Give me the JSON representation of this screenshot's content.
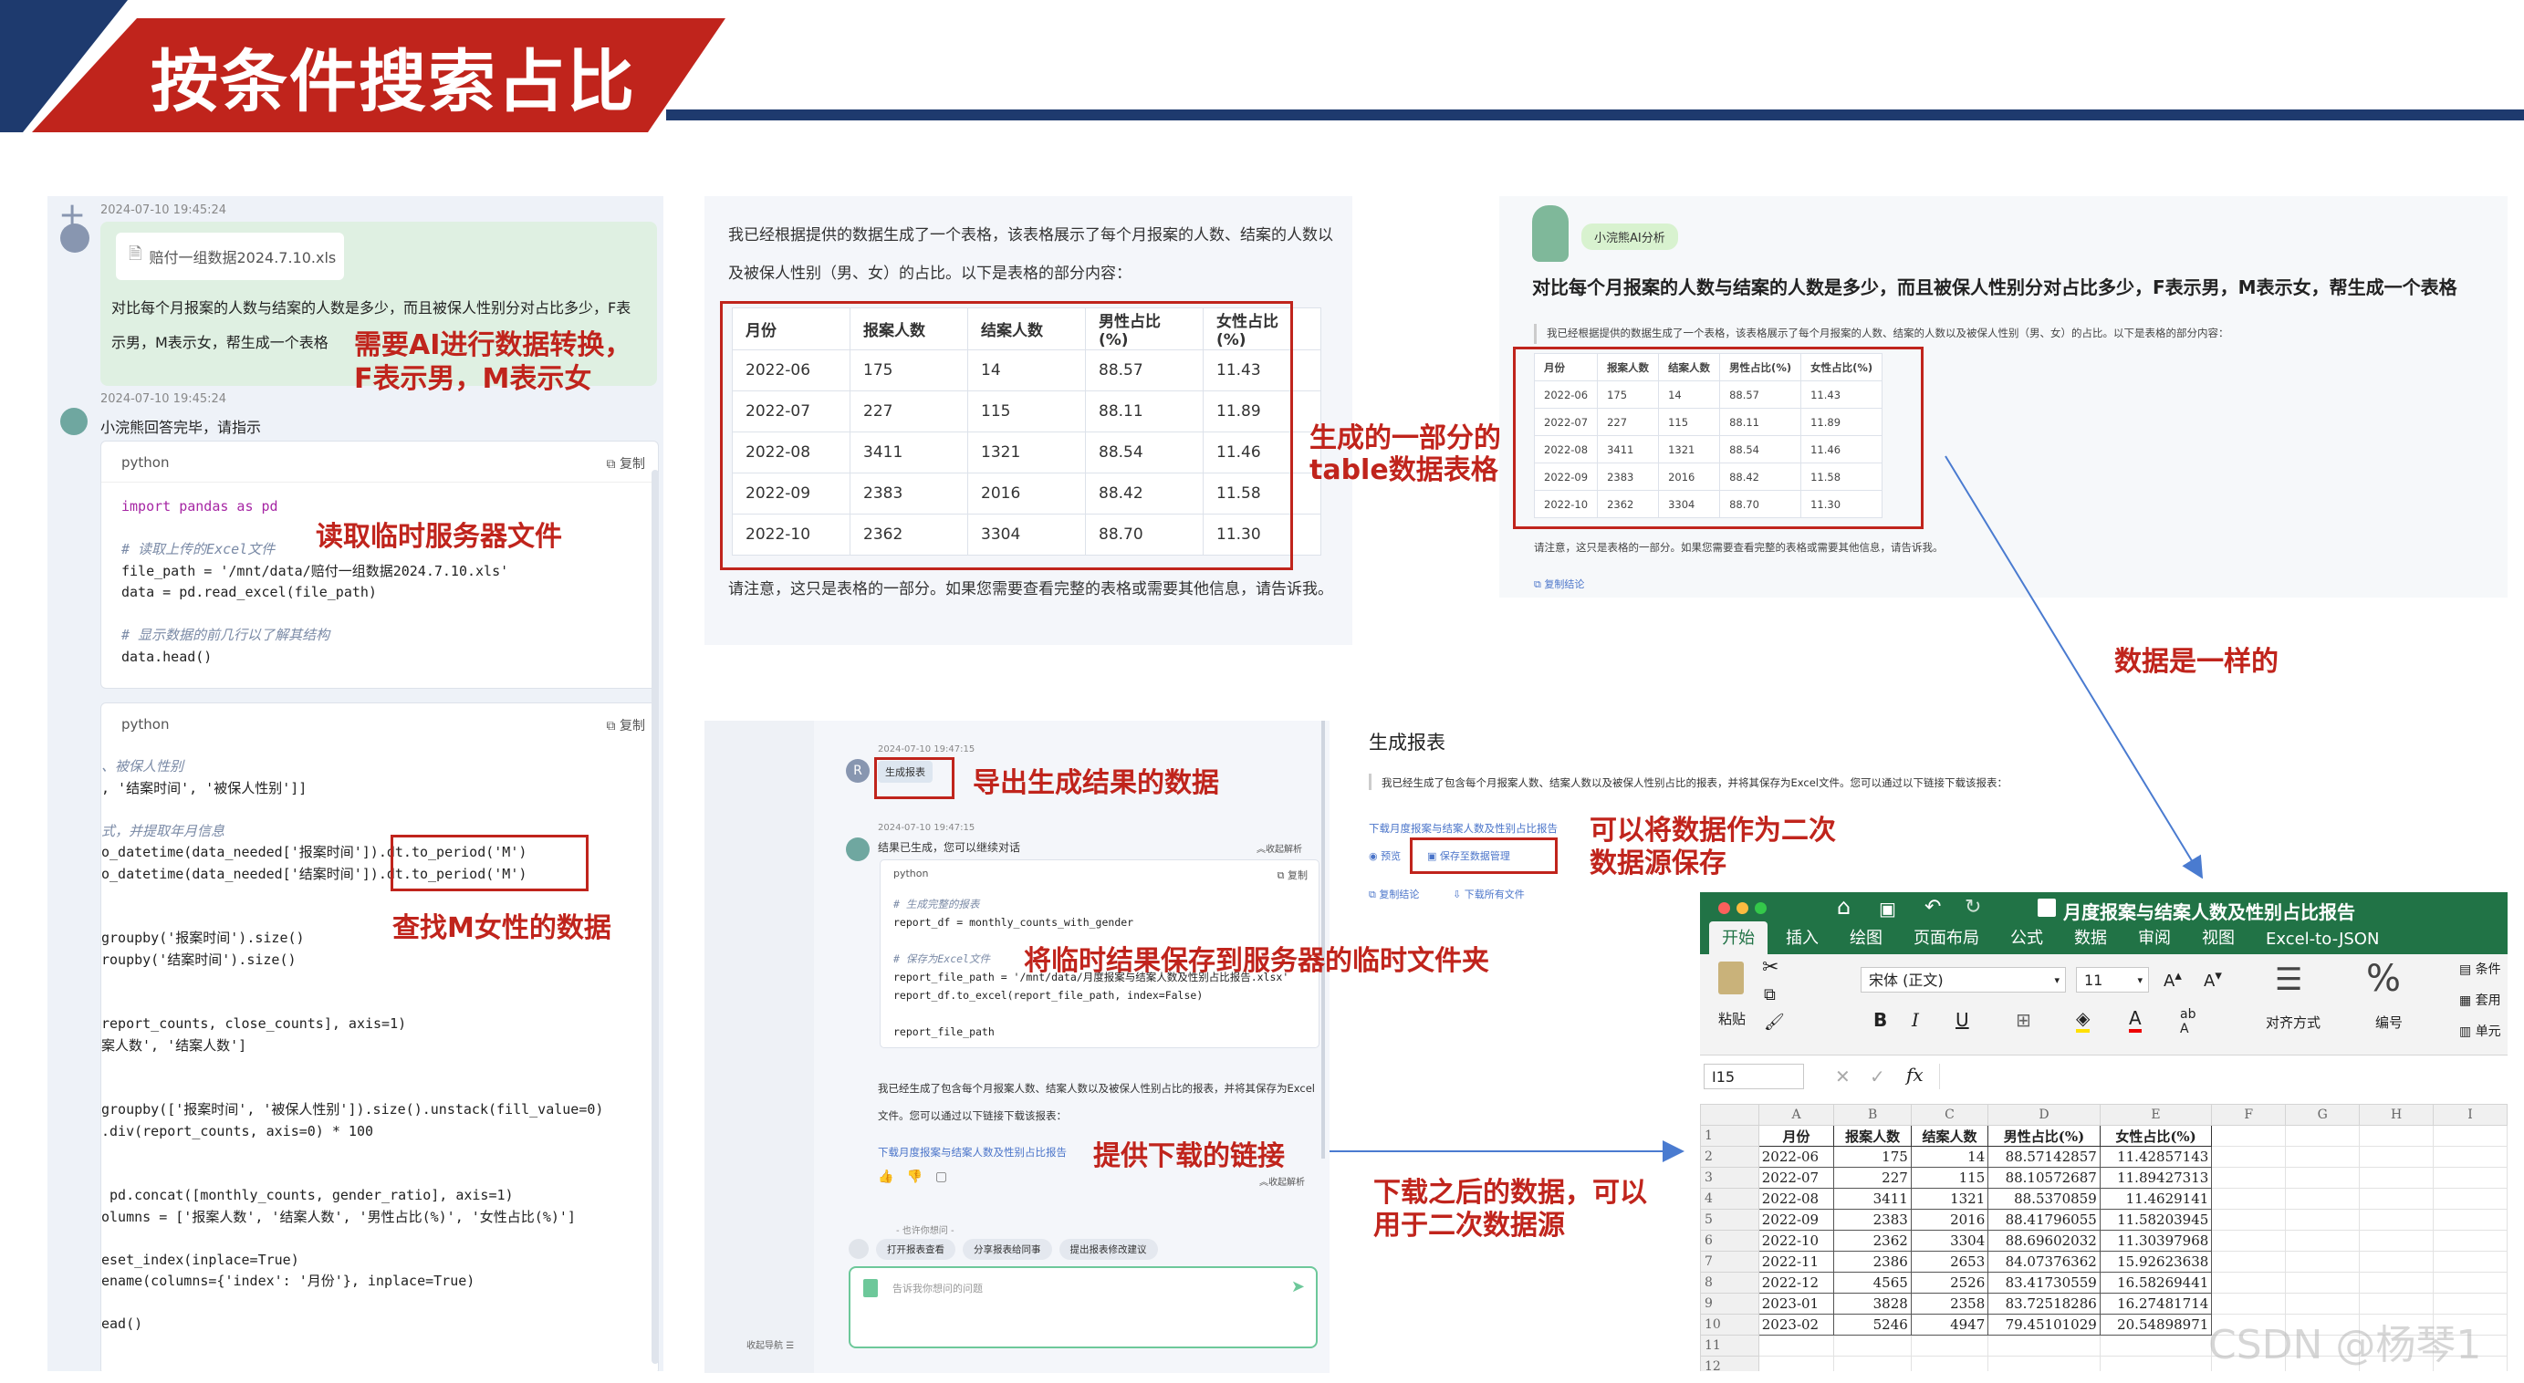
{
  "header": {
    "title": "按条件搜索占比"
  },
  "left_panel": {
    "timestamp1": "2024-07-10 19:45:24",
    "file_name": "赔付一组数据2024.7.10.xls",
    "user_message": "对比每个月报案的人数与结案的人数是多少，而且被保人性别分对占比多少，F表示男，M表示女，帮生成一个表格",
    "timestamp2": "2024-07-10 19:45:24",
    "bot_reply": "小浣熊回答完毕，请指示",
    "code1": {
      "lang": "python",
      "copy": "复制",
      "lines": [
        {
          "t": "import pandas as pd",
          "c": "kw"
        },
        {
          "t": "",
          "c": ""
        },
        {
          "t": "# 读取上传的Excel文件",
          "c": "cm"
        },
        {
          "t": "file_path = '/mnt/data/赔付一组数据2024.7.10.xls'",
          "c": ""
        },
        {
          "t": "data = pd.read_excel(file_path)",
          "c": ""
        },
        {
          "t": "",
          "c": ""
        },
        {
          "t": "# 显示数据的前几行以了解其结构",
          "c": "cm"
        },
        {
          "t": "data.head()",
          "c": ""
        }
      ]
    },
    "code2": {
      "lang": "python",
      "copy": "复制",
      "lines": [
        {
          "t": "、被保人性别",
          "c": "cm"
        },
        {
          "t": ", '结案时间', '被保人性别']]",
          "c": ""
        },
        {
          "t": "",
          "c": ""
        },
        {
          "t": "式，并提取年月信息",
          "c": "cm"
        },
        {
          "t": "o_datetime(data_needed['报案时间']).dt.to_period('M')",
          "c": ""
        },
        {
          "t": "o_datetime(data_needed['结案时间']).dt.to_period('M')",
          "c": ""
        },
        {
          "t": "",
          "c": ""
        },
        {
          "t": "",
          "c": ""
        },
        {
          "t": "groupby('报案时间').size()",
          "c": ""
        },
        {
          "t": "roupby('结案时间').size()",
          "c": ""
        },
        {
          "t": "",
          "c": ""
        },
        {
          "t": "",
          "c": ""
        },
        {
          "t": "report_counts, close_counts], axis=1)",
          "c": ""
        },
        {
          "t": "案人数', '结案人数']",
          "c": ""
        },
        {
          "t": "",
          "c": ""
        },
        {
          "t": "",
          "c": ""
        },
        {
          "t": "groupby(['报案时间', '被保人性别']).size().unstack(fill_value=0)",
          "c": ""
        },
        {
          "t": ".div(report_counts, axis=0) * 100",
          "c": ""
        },
        {
          "t": "",
          "c": ""
        },
        {
          "t": "",
          "c": ""
        },
        {
          "t": " pd.concat([monthly_counts, gender_ratio], axis=1)",
          "c": ""
        },
        {
          "t": "olumns = ['报案人数', '结案人数', '男性占比(%)', '女性占比(%)']",
          "c": ""
        },
        {
          "t": "",
          "c": ""
        },
        {
          "t": "eset_index(inplace=True)",
          "c": ""
        },
        {
          "t": "ename(columns={'index': '月份'}, inplace=True)",
          "c": ""
        },
        {
          "t": "",
          "c": ""
        },
        {
          "t": "ead()",
          "c": ""
        }
      ]
    }
  },
  "annotations": {
    "a1": "需要AI进行数据转换，",
    "a1b": "F表示男，M表示女",
    "a2": "读取临时服务器文件",
    "a3": "查找M女性的数据",
    "a4": "生成的一部分的",
    "a4b": "table数据表格",
    "a5": "数据是一样的",
    "a6": "导出生成结果的数据",
    "a7": "可以将数据作为二次",
    "a7b": "数据源保存",
    "a8": "将临时结果保存到服务器的临时文件夹",
    "a9": "提供下载的链接",
    "a10": "下载之后的数据，可以",
    "a10b": "用于二次数据源"
  },
  "mid_top": {
    "intro": "我已经根据提供的数据生成了一个表格，该表格展示了每个月报案的人数、结案的人数以及被保人性别（男、女）的占比。以下是表格的部分内容：",
    "outro": "请注意，这只是表格的一部分。如果您需要查看完整的表格或需要其他信息，请告诉我。"
  },
  "table": {
    "headers": [
      "月份",
      "报案人数",
      "结案人数",
      "男性占比(%)",
      "女性占比(%)"
    ],
    "rows": [
      [
        "2022-06",
        "175",
        "14",
        "88.57",
        "11.43"
      ],
      [
        "2022-07",
        "227",
        "115",
        "88.11",
        "11.89"
      ],
      [
        "2022-08",
        "3411",
        "1321",
        "88.54",
        "11.46"
      ],
      [
        "2022-09",
        "2383",
        "2016",
        "88.42",
        "11.58"
      ],
      [
        "2022-10",
        "2362",
        "3304",
        "88.70",
        "11.30"
      ]
    ]
  },
  "right_top": {
    "badge": "小浣熊AI分析",
    "question": "对比每个月报案的人数与结案的人数是多少，而且被保人性别分对占比多少，F表示男，M表示女，帮生成一个表格",
    "intro": "我已经根据提供的数据生成了一个表格，该表格展示了每个月报案的人数、结案的人数以及被保人性别（男、女）的占比。以下是表格的部分内容：",
    "outro": "请注意，这只是表格的一部分。如果您需要查看完整的表格或需要其他信息，请告诉我。",
    "copy_link": "复制结论"
  },
  "mid_bottom": {
    "timestamp": "2024-07-10 19:47:15",
    "report_btn": "生成报表",
    "status": "结果已生成，您可以继续对话",
    "collapse": "收起解析",
    "code_lang": "python",
    "code_copy": "复制",
    "code_lines": [
      {
        "t": "# 生成完整的报表",
        "c": "cm"
      },
      {
        "t": "report_df = monthly_counts_with_gender",
        "c": ""
      },
      {
        "t": "",
        "c": ""
      },
      {
        "t": "# 保存为Excel文件",
        "c": "cm"
      },
      {
        "t": "report_file_path = '/mnt/data/月度报案与结案人数及性别占比报告.xlsx'",
        "c": ""
      },
      {
        "t": "report_df.to_excel(report_file_path, index=False)",
        "c": ""
      },
      {
        "t": "",
        "c": ""
      },
      {
        "t": "report_file_path",
        "c": ""
      }
    ],
    "saved_text": "我已经生成了包含每个月报案人数、结案人数以及被保人性别占比的报表，并将其保存为Excel文件。您可以通过以下链接下载该报表：",
    "download_link": "下载月度报案与结案人数及性别占比报告",
    "collapse2": "收起解析",
    "ask_label": "- 也许你想问 -",
    "chips": [
      "打开报表查看",
      "分享报表给同事",
      "提出报表修改建议"
    ],
    "input_placeholder": "告诉我你想问的问题",
    "nav": "收起导航"
  },
  "report_panel": {
    "title": "生成报表",
    "text": "我已经生成了包含每个月报案人数、结案人数以及被保人性别占比的报表，并将其保存为Excel文件。您可以通过以下链接下载该报表：",
    "link": "下载月度报案与结案人数及性别占比报告",
    "preview": "预览",
    "save": "保存至数据管理",
    "copy": "复制结论",
    "download_all": "下载所有文件"
  },
  "excel": {
    "title": "月度报案与结案人数及性别占比报告",
    "tabs": [
      "开始",
      "插入",
      "绘图",
      "页面布局",
      "公式",
      "数据",
      "审阅",
      "视图",
      "Excel-to-JSON"
    ],
    "paste": "粘贴",
    "font": "宋体 (正文)",
    "size": "11",
    "align": "对齐方式",
    "number": "编号",
    "right_items": [
      "条件",
      "套用",
      "单元"
    ],
    "cell_ref": "I15",
    "fx": "fx",
    "cols": [
      "A",
      "B",
      "C",
      "D",
      "E",
      "F",
      "G",
      "H",
      "I"
    ],
    "header_row": [
      "月份",
      "报案人数",
      "结案人数",
      "男性占比(%)",
      "女性占比(%)"
    ],
    "rows": [
      [
        "2022-06",
        "175",
        "14",
        "88.57142857",
        "11.42857143"
      ],
      [
        "2022-07",
        "227",
        "115",
        "88.10572687",
        "11.89427313"
      ],
      [
        "2022-08",
        "3411",
        "1321",
        "88.5370859",
        "11.4629141"
      ],
      [
        "2022-09",
        "2383",
        "2016",
        "88.41796055",
        "11.58203945"
      ],
      [
        "2022-10",
        "2362",
        "3304",
        "88.69602032",
        "11.30397968"
      ],
      [
        "2022-11",
        "2386",
        "2653",
        "84.07376362",
        "15.92623638"
      ],
      [
        "2022-12",
        "4565",
        "2526",
        "83.41730559",
        "16.58269441"
      ],
      [
        "2023-01",
        "3828",
        "2358",
        "83.72518286",
        "16.27481714"
      ],
      [
        "2023-02",
        "5246",
        "4947",
        "79.45101029",
        "20.54898971"
      ]
    ],
    "row_numbers": [
      "1",
      "2",
      "3",
      "4",
      "5",
      "6",
      "7",
      "8",
      "9",
      "10",
      "11",
      "12"
    ]
  },
  "watermark": "CSDN @杨琴1"
}
